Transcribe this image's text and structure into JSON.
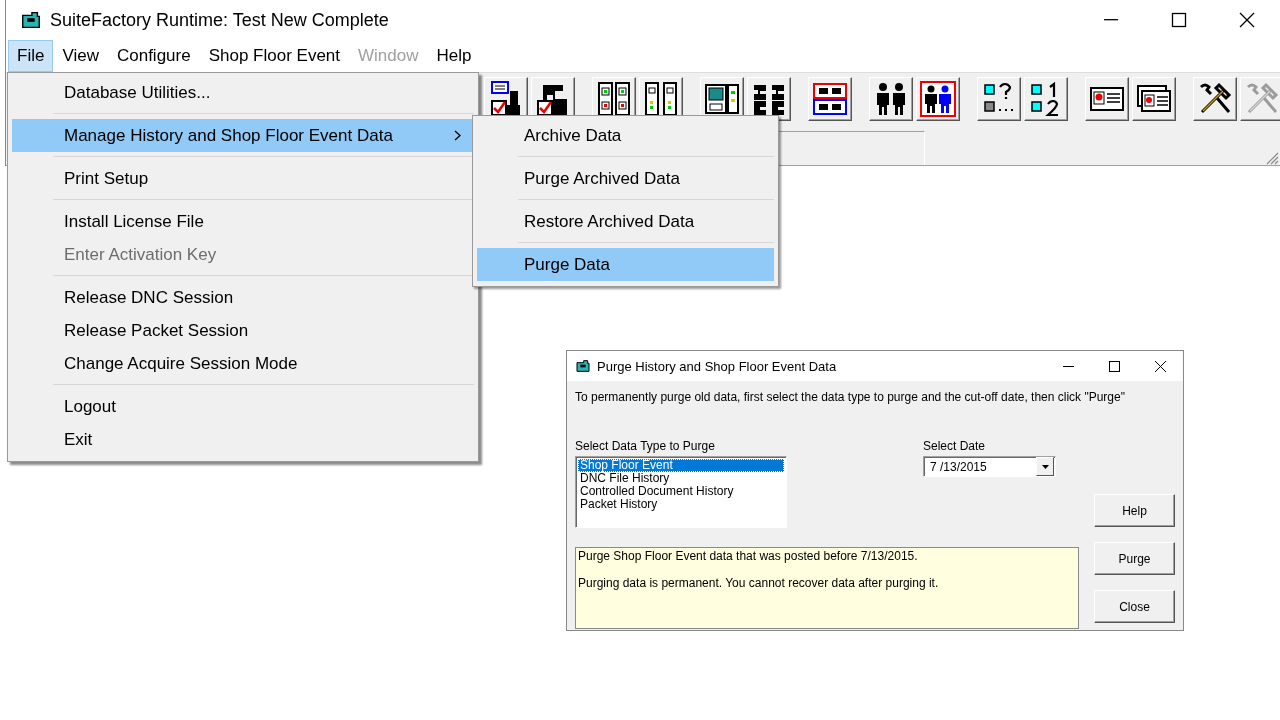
{
  "window": {
    "title": "SuiteFactory Runtime: Test New Complete"
  },
  "menubar": [
    {
      "label": "File",
      "selected": true,
      "disabled": false
    },
    {
      "label": "View",
      "selected": false,
      "disabled": false
    },
    {
      "label": "Configure",
      "selected": false,
      "disabled": false
    },
    {
      "label": "Shop Floor Event",
      "selected": false,
      "disabled": false
    },
    {
      "label": "Window",
      "selected": false,
      "disabled": true
    },
    {
      "label": "Help",
      "selected": false,
      "disabled": false
    }
  ],
  "toolbar": {
    "groups": [
      [
        {
          "kind": "form_check",
          "disabled": false
        },
        {
          "kind": "machine_check",
          "disabled": false
        }
      ],
      [
        {
          "kind": "racks_four",
          "disabled": false
        },
        {
          "kind": "racks_two",
          "disabled": false
        }
      ],
      [
        {
          "kind": "device",
          "disabled": false
        },
        {
          "kind": "blocks",
          "disabled": false
        }
      ],
      [
        {
          "kind": "blocks_framed",
          "disabled": false
        }
      ],
      [
        {
          "kind": "people",
          "disabled": false
        },
        {
          "kind": "people_framed",
          "disabled": false
        }
      ],
      [
        {
          "kind": "squares_query",
          "disabled": false
        },
        {
          "kind": "squares_numbers",
          "disabled": false
        }
      ],
      [
        {
          "kind": "card",
          "disabled": false
        },
        {
          "kind": "cards",
          "disabled": false
        }
      ],
      [
        {
          "kind": "tools",
          "disabled": false
        },
        {
          "kind": "tools",
          "disabled": true
        }
      ]
    ]
  },
  "file_menu": {
    "items": [
      {
        "kind": "item",
        "label": "Database Utilities...",
        "selected": false,
        "disabled": false,
        "submenu": false
      },
      {
        "kind": "separator"
      },
      {
        "kind": "item",
        "label": "Manage History and Shop Floor Event Data",
        "selected": true,
        "disabled": false,
        "submenu": true
      },
      {
        "kind": "separator"
      },
      {
        "kind": "item",
        "label": "Print Setup",
        "selected": false,
        "disabled": false,
        "submenu": false
      },
      {
        "kind": "separator"
      },
      {
        "kind": "item",
        "label": "Install License File",
        "selected": false,
        "disabled": false,
        "submenu": false
      },
      {
        "kind": "item",
        "label": "Enter Activation Key",
        "selected": false,
        "disabled": true,
        "submenu": false
      },
      {
        "kind": "separator"
      },
      {
        "kind": "item",
        "label": "Release DNC Session",
        "selected": false,
        "disabled": false,
        "submenu": false
      },
      {
        "kind": "item",
        "label": "Release Packet Session",
        "selected": false,
        "disabled": false,
        "submenu": false
      },
      {
        "kind": "item",
        "label": "Change Acquire Session Mode",
        "selected": false,
        "disabled": false,
        "submenu": false
      },
      {
        "kind": "separator"
      },
      {
        "kind": "item",
        "label": "Logout",
        "selected": false,
        "disabled": false,
        "submenu": false
      },
      {
        "kind": "item",
        "label": "Exit",
        "selected": false,
        "disabled": false,
        "submenu": false
      }
    ]
  },
  "submenu": {
    "items": [
      {
        "kind": "item",
        "label": "Archive Data",
        "selected": false
      },
      {
        "kind": "separator"
      },
      {
        "kind": "item",
        "label": "Purge Archived Data",
        "selected": false
      },
      {
        "kind": "separator"
      },
      {
        "kind": "item",
        "label": "Restore Archived Data",
        "selected": false
      },
      {
        "kind": "separator"
      },
      {
        "kind": "item",
        "label": "Purge Data",
        "selected": true
      }
    ]
  },
  "dialog": {
    "title": "Purge History and Shop Floor Event Data",
    "instruction": "To permanently purge old data, first select the data type to purge and the cut-off date, then click \"Purge\"",
    "type_label": "Select Data Type to Purge",
    "data_types": [
      {
        "label": "Shop Floor Event",
        "selected": true
      },
      {
        "label": "DNC File History",
        "selected": false
      },
      {
        "label": "Controlled Document History",
        "selected": false
      },
      {
        "label": "Packet History",
        "selected": false
      }
    ],
    "date_label": "Select Date",
    "date": "7 /13/2015",
    "info": [
      "Purge Shop Floor Event data that was posted before 7/13/2015.",
      "Purging data is permanent. You cannot recover data after purging it."
    ],
    "buttons": [
      "Help",
      "Purge",
      "Close"
    ]
  }
}
